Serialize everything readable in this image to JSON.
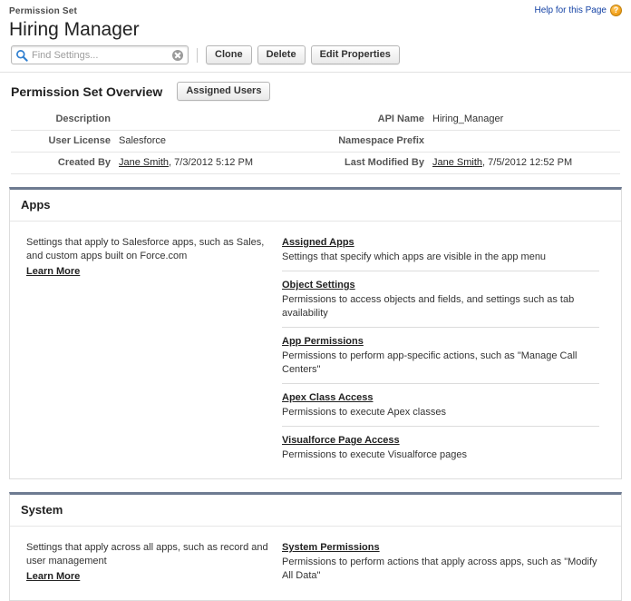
{
  "header": {
    "eyebrow": "Permission Set",
    "title": "Hiring Manager",
    "help_label": "Help for this Page",
    "help_badge": "?",
    "help_color": "#f5a623",
    "link_color": "#1543a5"
  },
  "toolbar": {
    "search_placeholder": "Find Settings...",
    "search_value": "",
    "clear_label": "",
    "buttons": [
      {
        "label": "Clone"
      },
      {
        "label": "Delete"
      },
      {
        "label": "Edit Properties"
      }
    ]
  },
  "overview": {
    "title": "Permission Set Overview",
    "assigned_users_button": "Assigned Users",
    "rows": [
      {
        "left_label": "Description",
        "left_value": "",
        "right_label": "API Name",
        "right_value": "Hiring_Manager"
      },
      {
        "left_label": "User License",
        "left_value": "Salesforce",
        "right_label": "Namespace Prefix",
        "right_value": ""
      },
      {
        "left_label": "Created By",
        "left_link": "Jane Smith",
        "left_value": ", 7/3/2012 5:12 PM",
        "right_label": "Last Modified By",
        "right_link": "Jane Smith",
        "right_value": ", 7/5/2012 12:52 PM"
      }
    ]
  },
  "sections": [
    {
      "title": "Apps",
      "description": "Settings that apply to Salesforce apps, such as Sales, and custom apps built on Force.com",
      "learn_more": "Learn More",
      "links": [
        {
          "title": "Assigned Apps",
          "desc": "Settings that specify which apps are visible in the app menu"
        },
        {
          "title": "Object Settings",
          "desc": "Permissions to access objects and fields, and settings such as tab availability"
        },
        {
          "title": "App Permissions",
          "desc": "Permissions to perform app-specific actions, such as \"Manage Call Centers\""
        },
        {
          "title": "Apex Class Access",
          "desc": "Permissions to execute Apex classes"
        },
        {
          "title": "Visualforce Page Access",
          "desc": "Permissions to execute Visualforce pages"
        }
      ]
    },
    {
      "title": "System",
      "description": "Settings that apply across all apps, such as record and user management",
      "learn_more": "Learn More",
      "links": [
        {
          "title": "System Permissions",
          "desc": "Permissions to perform actions that apply across apps, such as \"Modify All Data\""
        }
      ]
    }
  ]
}
